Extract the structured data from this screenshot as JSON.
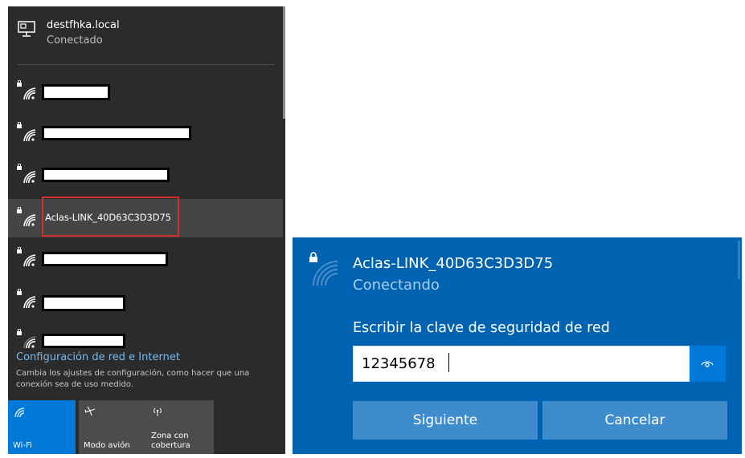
{
  "flyout": {
    "connected_network": {
      "name": "destfhka.local",
      "status": "Conectado"
    },
    "networks": [
      {
        "label": "",
        "redacted": true
      },
      {
        "label": "",
        "redacted": true
      },
      {
        "label": "",
        "redacted": true
      },
      {
        "label": "Aclas-LINK_40D63C3D3D75",
        "redacted": false,
        "selected": true
      },
      {
        "label": "",
        "redacted": true
      },
      {
        "label": "",
        "redacted": true
      },
      {
        "label": "",
        "redacted": true
      }
    ],
    "settings_link": "Configuración de red e Internet",
    "settings_description": "Cambia los ajustes de configuración, como hacer que una conexión sea de uso medido.",
    "quick_actions": {
      "wifi": "Wi-Fi",
      "airplane": "Modo avión",
      "hotspot": "Zona con cobertura"
    }
  },
  "connect_panel": {
    "ssid": "Aclas-LINK_40D63C3D3D75",
    "status": "Conectando",
    "prompt": "Escribir la clave de seguridad de red",
    "password_value": "12345678",
    "next_button": "Siguiente",
    "cancel_button": "Cancelar"
  },
  "colors": {
    "flyout_bg": "#2b2b2b",
    "accent_blue": "#0078d7",
    "panel_blue": "#0063b1",
    "highlight_red": "#d32f2f",
    "link_blue": "#76b9ed"
  }
}
